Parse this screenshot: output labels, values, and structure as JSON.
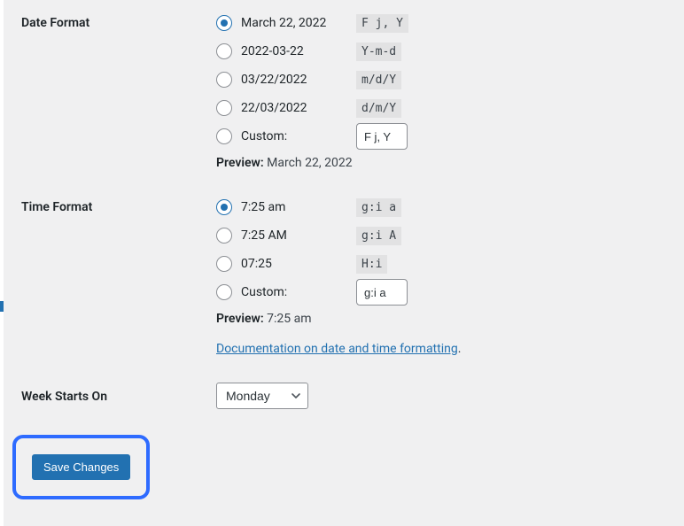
{
  "sections": {
    "date_format": {
      "label": "Date Format",
      "options": [
        {
          "label": "March 22, 2022",
          "code": "F j, Y",
          "checked": true
        },
        {
          "label": "2022-03-22",
          "code": "Y-m-d",
          "checked": false
        },
        {
          "label": "03/22/2022",
          "code": "m/d/Y",
          "checked": false
        },
        {
          "label": "22/03/2022",
          "code": "d/m/Y",
          "checked": false
        }
      ],
      "custom_label": "Custom:",
      "custom_value": "F j, Y",
      "preview_label": "Preview:",
      "preview_value": "March 22, 2022"
    },
    "time_format": {
      "label": "Time Format",
      "options": [
        {
          "label": "7:25 am",
          "code": "g:i a",
          "checked": true
        },
        {
          "label": "7:25 AM",
          "code": "g:i A",
          "checked": false
        },
        {
          "label": "07:25",
          "code": "H:i",
          "checked": false
        }
      ],
      "custom_label": "Custom:",
      "custom_value": "g:i a",
      "preview_label": "Preview:",
      "preview_value": "7:25 am",
      "doc_link_text": "Documentation on date and time formatting",
      "doc_link_suffix": "."
    },
    "week_starts": {
      "label": "Week Starts On",
      "selected": "Monday"
    }
  },
  "save_button_label": "Save Changes"
}
